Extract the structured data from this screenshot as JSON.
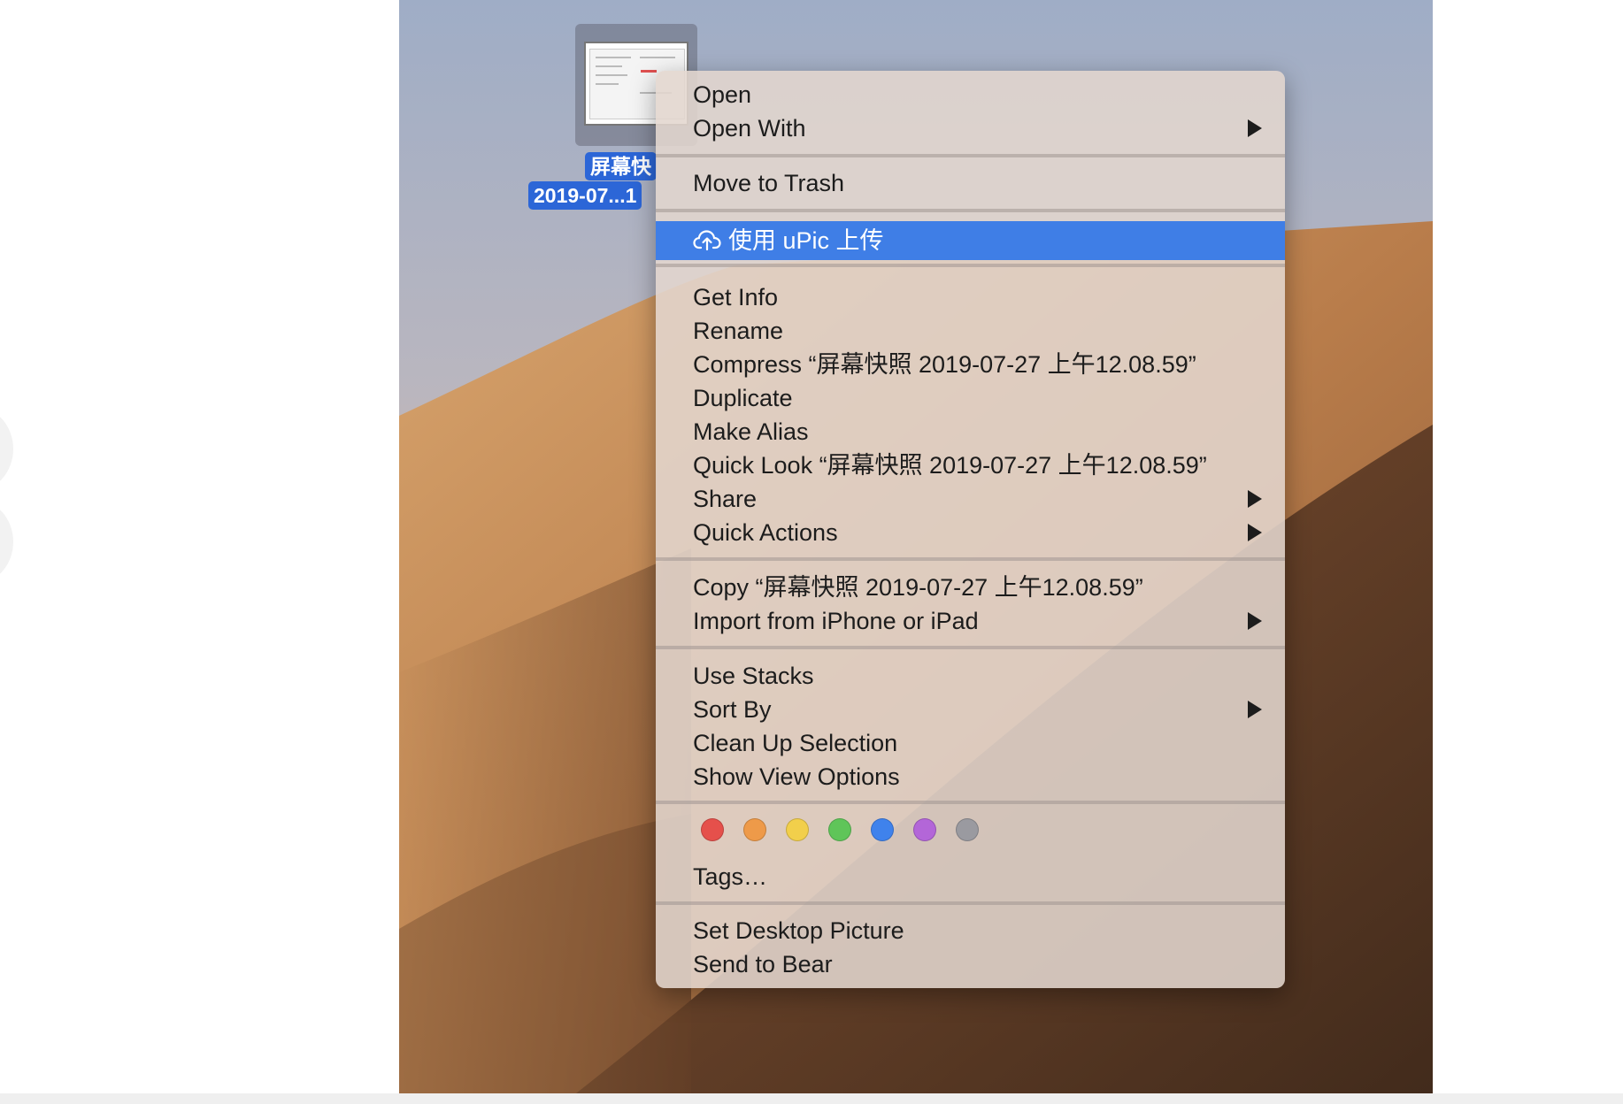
{
  "file": {
    "label_line1": "屏幕快",
    "label_line2": "2019-07...1"
  },
  "menu": {
    "open": "Open",
    "open_with": "Open With",
    "move_to_trash": "Move to Trash",
    "upload_upic": "使用 uPic 上传",
    "get_info": "Get Info",
    "rename": "Rename",
    "compress": "Compress “屏幕快照 2019-07-27 上午12.08.59”",
    "duplicate": "Duplicate",
    "make_alias": "Make Alias",
    "quick_look": "Quick Look “屏幕快照 2019-07-27 上午12.08.59”",
    "share": "Share",
    "quick_actions": "Quick Actions",
    "copy": "Copy “屏幕快照 2019-07-27 上午12.08.59”",
    "import_iphone": "Import from iPhone or iPad",
    "use_stacks": "Use Stacks",
    "sort_by": "Sort By",
    "clean_up": "Clean Up Selection",
    "show_view_options": "Show View Options",
    "tags": "Tags…",
    "set_desktop_picture": "Set Desktop Picture",
    "send_to_bear": "Send to Bear"
  },
  "tag_colors": [
    "#e5504b",
    "#ee9a49",
    "#f2cf4b",
    "#5fc559",
    "#3f82ec",
    "#b366d8",
    "#9a9aa0"
  ],
  "colors": {
    "highlight": "#3f7ee6",
    "selection_label": "#2c66d7"
  }
}
